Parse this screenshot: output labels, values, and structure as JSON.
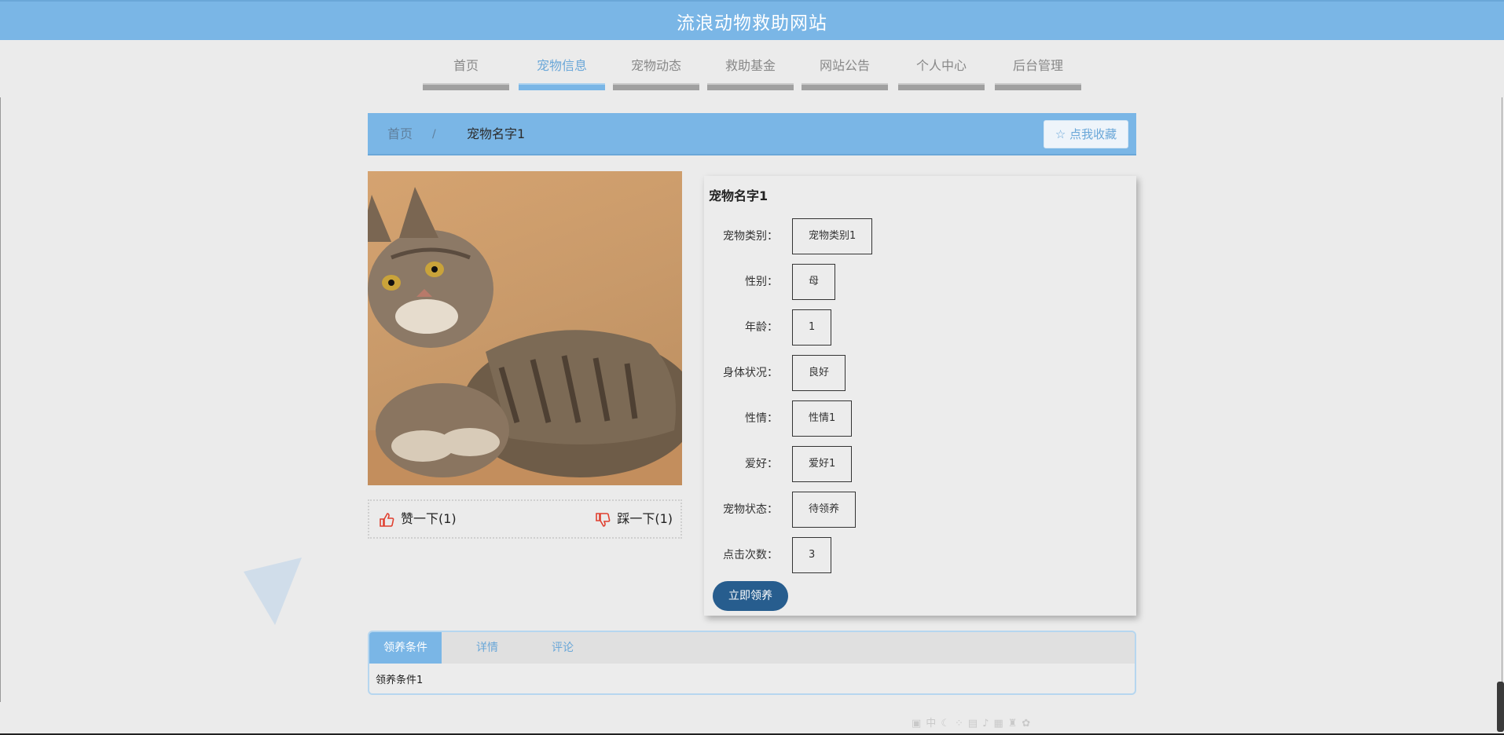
{
  "site": {
    "title": "流浪动物救助网站"
  },
  "nav": {
    "items": [
      {
        "label": "首页"
      },
      {
        "label": "宠物信息"
      },
      {
        "label": "宠物动态"
      },
      {
        "label": "救助基金"
      },
      {
        "label": "网站公告"
      },
      {
        "label": "个人中心"
      },
      {
        "label": "后台管理"
      }
    ],
    "active": "宠物信息"
  },
  "breadcrumb": {
    "home": "首页",
    "separator": "/",
    "current": "宠物名字1",
    "favorite_label": "点我收藏"
  },
  "pet": {
    "name": "宠物名字1",
    "image_icon": "cat-photo",
    "fields": [
      {
        "label": "宠物类别：",
        "value": "宠物类别1"
      },
      {
        "label": "性别：",
        "value": "母"
      },
      {
        "label": "年龄：",
        "value": "1"
      },
      {
        "label": "身体状况：",
        "value": "良好"
      },
      {
        "label": "性情：",
        "value": "性情1"
      },
      {
        "label": "爱好：",
        "value": "爱好1"
      },
      {
        "label": "宠物状态：",
        "value": "待领养"
      },
      {
        "label": "点击次数：",
        "value": "3"
      }
    ],
    "adopt_label": "立即领养"
  },
  "vote": {
    "up_label": "赞一下(1)",
    "down_label": "踩一下(1)"
  },
  "tabs": {
    "items": [
      {
        "label": "领养条件"
      },
      {
        "label": "详情"
      },
      {
        "label": "评论"
      }
    ],
    "active": "领养条件",
    "content": "领养条件1"
  },
  "colors": {
    "primary": "#7ab6e6",
    "adopt_button": "#275d8e",
    "background": "#ebebeb"
  }
}
